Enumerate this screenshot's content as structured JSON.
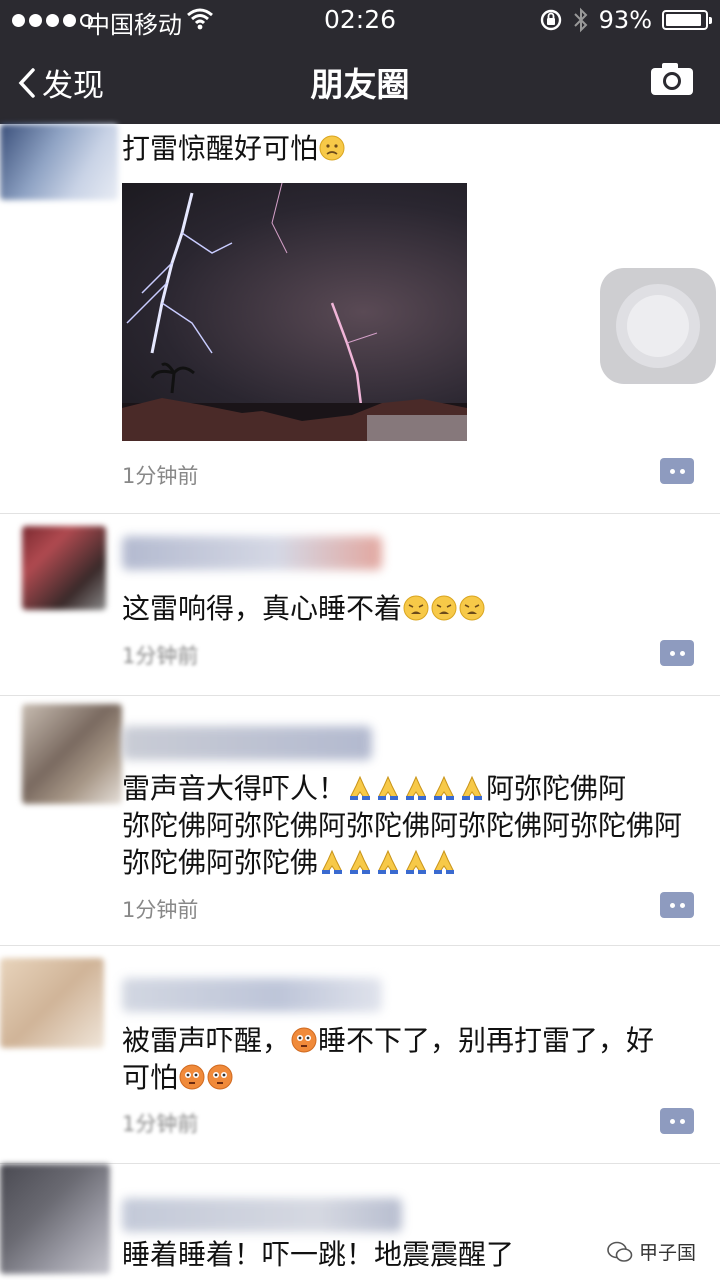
{
  "status_bar": {
    "carrier": "中国移动",
    "time": "02:26",
    "battery": "93%",
    "battery_level": 0.93
  },
  "nav": {
    "back_label": "发现",
    "title": "朋友圈",
    "camera_icon": "camera-icon"
  },
  "posts": [
    {
      "text": "打雷惊醒好可怕",
      "time": "1分钟前",
      "image": "lightning-photo"
    },
    {
      "text": "这雷响得，真心睡不着",
      "time": "1分钟前"
    },
    {
      "text_line1": "雷声音大得吓人！",
      "text_mid": "阿弥陀佛阿",
      "text_line2": "弥陀佛阿弥陀佛阿弥陀佛阿弥陀佛阿弥陀佛阿",
      "text_line3": "弥陀佛阿弥陀佛",
      "time": "1分钟前"
    },
    {
      "text_line1a": "被雷声吓醒，",
      "text_line1b": "睡不下了，别再打雷了，好",
      "text_line2": "可怕",
      "time": "1分钟前"
    },
    {
      "text": "睡着睡着！吓一跳！地震震醒了"
    }
  ],
  "watermark": {
    "label": "甲子国"
  },
  "colors": {
    "nav_bg": "#2b2a30",
    "comment_btn": "#8e9bbf"
  }
}
